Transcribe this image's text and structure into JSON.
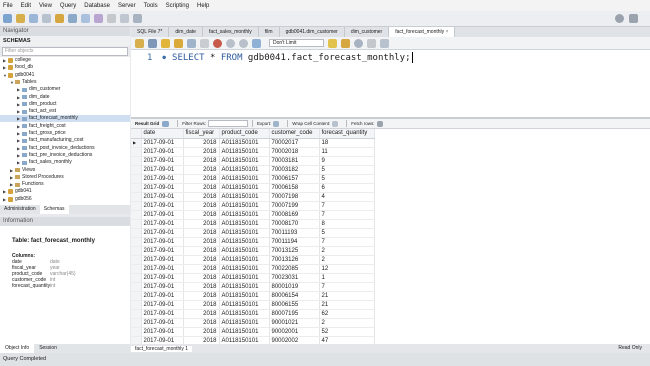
{
  "menu": [
    "File",
    "Edit",
    "View",
    "Query",
    "Database",
    "Server",
    "Tools",
    "Scripting",
    "Help"
  ],
  "navigator": {
    "header": "Navigator",
    "schemas_title": "SCHEMAS",
    "filter_placeholder": "Filter objects",
    "tree": [
      {
        "label": "college",
        "level": 0,
        "arrow": "▶",
        "kind": "db"
      },
      {
        "label": "food_db",
        "level": 0,
        "arrow": "▶",
        "kind": "db"
      },
      {
        "label": "gdb0041",
        "level": 0,
        "arrow": "▼",
        "kind": "db"
      },
      {
        "label": "Tables",
        "level": 1,
        "arrow": "▼",
        "kind": "folder"
      },
      {
        "label": "dim_customer",
        "level": 2,
        "arrow": "▶",
        "kind": "table"
      },
      {
        "label": "dim_date",
        "level": 2,
        "arrow": "▶",
        "kind": "table"
      },
      {
        "label": "dim_product",
        "level": 2,
        "arrow": "▶",
        "kind": "table"
      },
      {
        "label": "fact_act_est",
        "level": 2,
        "arrow": "▶",
        "kind": "table"
      },
      {
        "label": "fact_forecast_monthly",
        "level": 2,
        "arrow": "▶",
        "kind": "table",
        "selected": true
      },
      {
        "label": "fact_freight_cost",
        "level": 2,
        "arrow": "▶",
        "kind": "table"
      },
      {
        "label": "fact_gross_price",
        "level": 2,
        "arrow": "▶",
        "kind": "table"
      },
      {
        "label": "fact_manufacturing_cost",
        "level": 2,
        "arrow": "▶",
        "kind": "table"
      },
      {
        "label": "fact_post_invoice_deductions",
        "level": 2,
        "arrow": "▶",
        "kind": "table"
      },
      {
        "label": "fact_pre_invoice_deductions",
        "level": 2,
        "arrow": "▶",
        "kind": "table"
      },
      {
        "label": "fact_sales_monthly",
        "level": 2,
        "arrow": "▶",
        "kind": "table"
      },
      {
        "label": "Views",
        "level": 1,
        "arrow": "▶",
        "kind": "folder"
      },
      {
        "label": "Stored Procedures",
        "level": 1,
        "arrow": "▶",
        "kind": "folder"
      },
      {
        "label": "Functions",
        "level": 1,
        "arrow": "▶",
        "kind": "folder"
      },
      {
        "label": "gdb041",
        "level": 0,
        "arrow": "▶",
        "kind": "db"
      },
      {
        "label": "gdb056",
        "level": 0,
        "arrow": "▶",
        "kind": "db"
      }
    ],
    "tabs": [
      "Administration",
      "Schemas"
    ]
  },
  "info": {
    "header": "Information",
    "table_label": "Table:",
    "table_name": "fact_forecast_monthly",
    "columns_title": "Columns:",
    "columns": [
      {
        "name": "date",
        "type": "date"
      },
      {
        "name": "fiscal_year",
        "type": "year"
      },
      {
        "name": "product_code",
        "type": "varchar(45)"
      },
      {
        "name": "customer_code",
        "type": "int"
      },
      {
        "name": "forecast_quantity",
        "type": "int"
      }
    ],
    "tabs": [
      "Object Info",
      "Session"
    ]
  },
  "editor": {
    "tabs": [
      "SQL File 7*",
      "dim_date",
      "fact_sales_monthly",
      "film",
      "gdb0041.dim_customer",
      "dim_customer",
      "fact_forecast_monthly"
    ],
    "active_tab": 6,
    "limit": "Don't Limit",
    "line_number": "1",
    "sql_kw1": "SELECT",
    "sql_mid": " * ",
    "sql_kw2": "FROM",
    "sql_rest": " gdb0041.fact_forecast_monthly;"
  },
  "results": {
    "toolbar": {
      "result_grid": "Result Grid",
      "filter_rows": "Filter Rows:",
      "export": "Export:",
      "wrap": "Wrap Cell Content:",
      "fetch": "Fetch rows:"
    },
    "columns": [
      "date",
      "fiscal_year",
      "product_code",
      "customer_code",
      "forecast_quantity"
    ],
    "rows": [
      [
        "2017-09-01",
        "2018",
        "A0118150101",
        "70002017",
        "18"
      ],
      [
        "2017-09-01",
        "2018",
        "A0118150101",
        "70002018",
        "11"
      ],
      [
        "2017-09-01",
        "2018",
        "A0118150101",
        "70003181",
        "9"
      ],
      [
        "2017-09-01",
        "2018",
        "A0118150101",
        "70003182",
        "5"
      ],
      [
        "2017-09-01",
        "2018",
        "A0118150101",
        "70006157",
        "5"
      ],
      [
        "2017-09-01",
        "2018",
        "A0118150101",
        "70006158",
        "6"
      ],
      [
        "2017-09-01",
        "2018",
        "A0118150101",
        "70007198",
        "4"
      ],
      [
        "2017-09-01",
        "2018",
        "A0118150101",
        "70007199",
        "7"
      ],
      [
        "2017-09-01",
        "2018",
        "A0118150101",
        "70008169",
        "7"
      ],
      [
        "2017-09-01",
        "2018",
        "A0118150101",
        "70008170",
        "8"
      ],
      [
        "2017-09-01",
        "2018",
        "A0118150101",
        "70011193",
        "5"
      ],
      [
        "2017-09-01",
        "2018",
        "A0118150101",
        "70011194",
        "7"
      ],
      [
        "2017-09-01",
        "2018",
        "A0118150101",
        "70013125",
        "2"
      ],
      [
        "2017-09-01",
        "2018",
        "A0118150101",
        "70013126",
        "2"
      ],
      [
        "2017-09-01",
        "2018",
        "A0118150101",
        "70022085",
        "12"
      ],
      [
        "2017-09-01",
        "2018",
        "A0118150101",
        "70023031",
        "1"
      ],
      [
        "2017-09-01",
        "2018",
        "A0118150101",
        "80001019",
        "7"
      ],
      [
        "2017-09-01",
        "2018",
        "A0118150101",
        "80006154",
        "21"
      ],
      [
        "2017-09-01",
        "2018",
        "A0118150101",
        "80006155",
        "21"
      ],
      [
        "2017-09-01",
        "2018",
        "A0118150101",
        "80007195",
        "62"
      ],
      [
        "2017-09-01",
        "2018",
        "A0118150101",
        "90001021",
        "2"
      ],
      [
        "2017-09-01",
        "2018",
        "A0118150101",
        "90002001",
        "52"
      ],
      [
        "2017-09-01",
        "2018",
        "A0118150101",
        "90002002",
        "47"
      ]
    ],
    "bottom_tab": "fact_forecast_monthly 1",
    "read_only": "Read Only"
  },
  "status": "Query Completed",
  "colors": {
    "accent": "#2c5aa0",
    "selected": "#cfdff1",
    "active_tab": "#ffffff"
  }
}
